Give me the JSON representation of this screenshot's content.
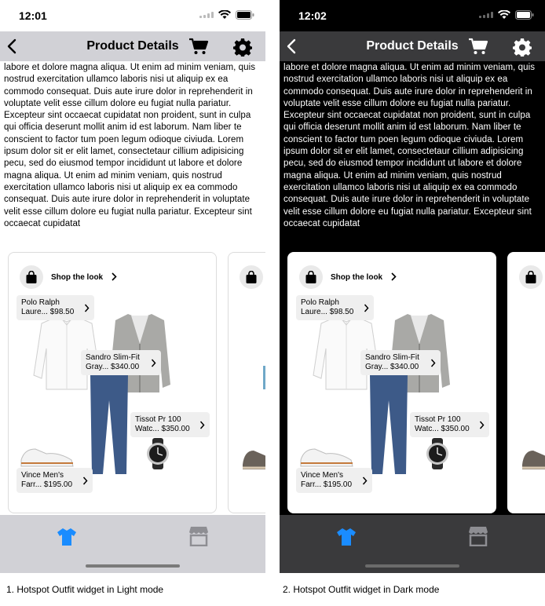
{
  "colors": {
    "accent": "#1a8cff",
    "store_icon_light": "#8e8e93",
    "store_icon_dark": "#8e8e93",
    "light_navbar": "#d1d1d6",
    "dark_navbar": "#3a3a3c"
  },
  "common": {
    "nav_title": "Product Details",
    "body_text": "labore et dolore magna aliqua. Ut enim ad minim veniam, quis nostrud exercitation ullamco laboris nisi ut aliquip ex ea commodo consequat. Duis aute irure dolor in reprehenderit in voluptate velit esse cillum dolore eu fugiat nulla pariatur. Excepteur sint occaecat cupidatat non proident, sunt in culpa qui officia deserunt mollit anim id est laborum. Nam liber te conscient to factor tum poen legum odioque civiuda. Lorem ipsum dolor sit er elit lamet, consectetaur cillium adipisicing pecu, sed do eiusmod tempor incididunt ut labore et dolore magna aliqua. Ut enim ad minim veniam, quis nostrud exercitation ullamco laboris nisi ut aliquip ex ea commodo consequat. Duis aute irure dolor in reprehenderit in voluptate velit esse cillum dolore eu fugiat nulla pariatur. Excepteur sint occaecat cupidatat",
    "shop_look_label": "Shop the look",
    "hotspots": [
      {
        "name": "Polo Ralph",
        "line2": "Laure... $98.50"
      },
      {
        "name": "Sandro Slim-Fit",
        "line2": "Gray... $340.00"
      },
      {
        "name": "Tissot Pr 100",
        "line2": "Watc... $350.00"
      },
      {
        "name": "Vince Men's",
        "line2": "Farr... $195.00"
      }
    ],
    "icons": {
      "back": "chevron-left-icon",
      "cart": "cart-icon",
      "settings": "gear-icon",
      "shop": "shopping-bag-icon",
      "tab1": "tshirt-icon",
      "tab2": "store-icon"
    }
  },
  "light": {
    "time": "12:01",
    "caption": "1. Hotspot Outfit widget in Light mode"
  },
  "dark": {
    "time": "12:02",
    "caption": "2. Hotspot Outfit widget in Dark mode"
  }
}
